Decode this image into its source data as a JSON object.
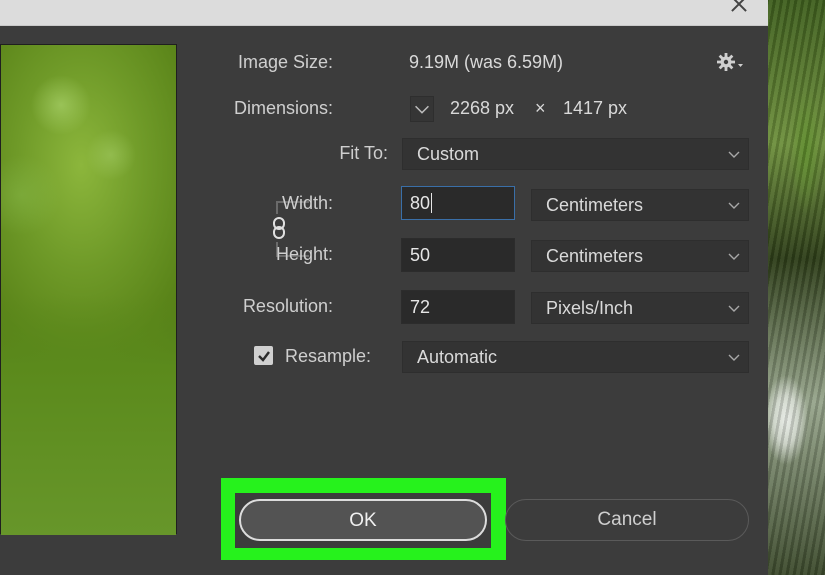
{
  "dialog": {
    "preview": {
      "description_icon": "image-preview"
    },
    "image_size": {
      "label": "Image Size:",
      "value": "9.19M (was 6.59M)"
    },
    "dimensions": {
      "label": "Dimensions:",
      "width": "2268 px",
      "times": "×",
      "height": "1417 px"
    },
    "fit_to": {
      "label": "Fit To:",
      "value": "Custom"
    },
    "width": {
      "label": "Width:",
      "value": "80",
      "unit": "Centimeters"
    },
    "height": {
      "label": "Height:",
      "value": "50",
      "unit": "Centimeters"
    },
    "resolution": {
      "label": "Resolution:",
      "value": "72",
      "unit": "Pixels/Inch"
    },
    "resample": {
      "label": "Resample:",
      "value": "Automatic",
      "checked": true
    },
    "buttons": {
      "ok": "OK",
      "cancel": "Cancel"
    },
    "icons": {
      "gear": "gear-icon",
      "link": "chain-link-icon",
      "close": "close-icon",
      "chevron": "chevron-down-icon",
      "check": "checkmark-icon"
    },
    "colors": {
      "highlight": "#26f21c",
      "focus": "#3a6fa8"
    }
  }
}
